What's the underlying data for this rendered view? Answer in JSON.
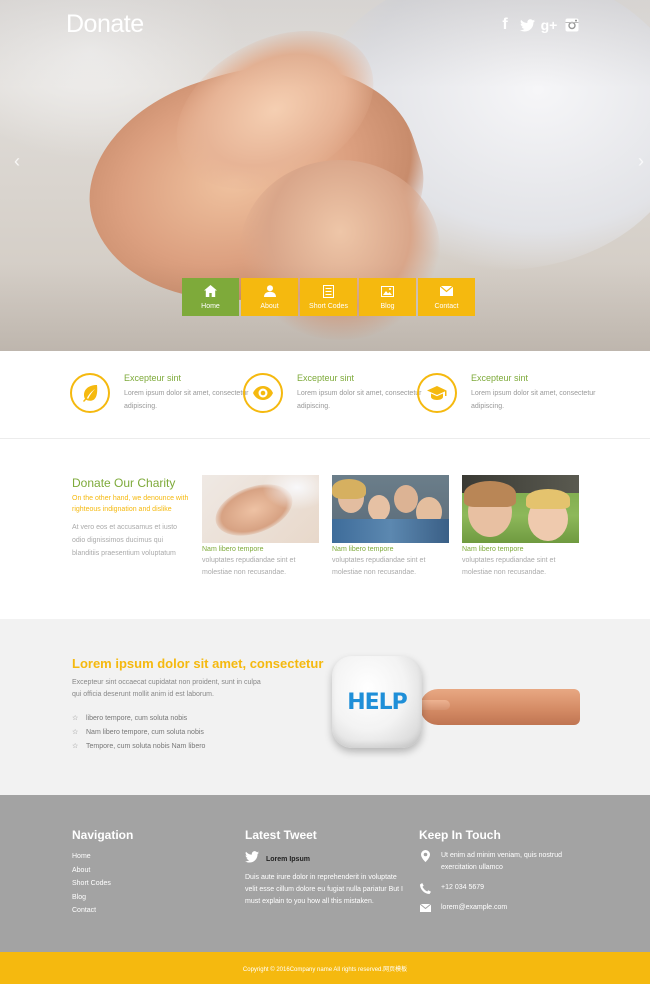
{
  "brand": {
    "title": "Donate",
    "accent": "#f5b90f",
    "green": "#7eaa3a"
  },
  "social": [
    {
      "name": "facebook-icon",
      "glyph": "f"
    },
    {
      "name": "twitter-icon",
      "glyph": "twitter"
    },
    {
      "name": "google-plus-icon",
      "glyph": "g+"
    },
    {
      "name": "instagram-icon",
      "glyph": "instagram"
    }
  ],
  "slider": {
    "prev": "‹",
    "next": "›"
  },
  "menu": [
    {
      "label": "Home",
      "icon": "home-icon"
    },
    {
      "label": "About",
      "icon": "user-icon"
    },
    {
      "label": "Short Codes",
      "icon": "list-icon"
    },
    {
      "label": "Blog",
      "icon": "image-icon"
    },
    {
      "label": "Contact",
      "icon": "envelope-icon"
    }
  ],
  "features": [
    {
      "title": "Excepteur sint",
      "desc": "Lorem ipsum dolor sit amet, consectetur adipiscing.",
      "icon": "leaf-icon"
    },
    {
      "title": "Excepteur sint",
      "desc": "Lorem ipsum dolor sit amet, consectetur adipiscing.",
      "icon": "eye-icon"
    },
    {
      "title": "Excepteur sint",
      "desc": "Lorem ipsum dolor sit amet, consectetur adipiscing.",
      "icon": "graduation-cap-icon"
    }
  ],
  "charity": {
    "title": "Donate Our Charity",
    "subtitle": "On the other hand, we denounce with righteous indignation and dislike",
    "text": "At vero eos et accusamus et iusto odio dignissimos ducimus qui blanditiis praesentium voluptatum",
    "cards": [
      {
        "title": "Nam libero tempore",
        "desc": "voluptates repudiandae sint et molestiae non recusandae."
      },
      {
        "title": "Nam libero tempore",
        "desc": "voluptates repudiandae sint et molestiae non recusandae."
      },
      {
        "title": "Nam libero tempore",
        "desc": "voluptates repudiandae sint et molestiae non recusandae."
      }
    ]
  },
  "help": {
    "title": "Lorem ipsum dolor sit amet, consectetur",
    "text": "Excepteur sint occaecat cupidatat non proident, sunt in culpa qui officia deserunt mollit anim id est laborum.",
    "list": [
      "libero tempore, cum soluta nobis",
      "Nam libero tempore, cum soluta nobis",
      "Tempore, cum soluta nobis Nam libero"
    ],
    "button": "HELP"
  },
  "footer": {
    "navigation": {
      "title": "Navigation",
      "items": [
        "Home",
        "About",
        "Short Codes",
        "Blog",
        "Contact"
      ]
    },
    "tweet": {
      "title": "Latest Tweet",
      "name": "Lorem Ipsum",
      "text": "Duis aute irure dolor in reprehenderit in voluptate velit esse cillum dolore eu fugiat nulla pariatur But I must explain to you how all this mistaken."
    },
    "contact": {
      "title": "Keep In Touch",
      "address": "Ut enim ad minim veniam, quis nostrud exercitation ullamco",
      "phone": "+12 034 5679",
      "email": "lorem@example.com"
    },
    "copyright": "Copyright © 2016Company name All rights reserved.网页模板"
  }
}
